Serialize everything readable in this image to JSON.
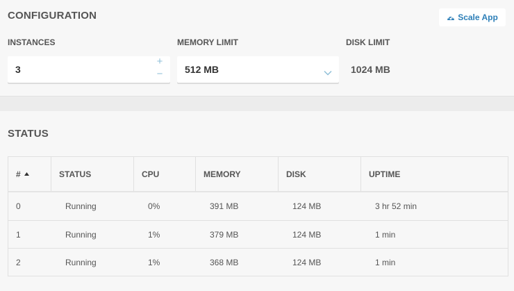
{
  "configuration": {
    "title": "CONFIGURATION",
    "scale_button": {
      "label": "Scale App",
      "icon": "dashboard-icon"
    },
    "instances": {
      "label": "INSTANCES",
      "value": "3",
      "plus": "+",
      "minus": "−"
    },
    "memory_limit": {
      "label": "MEMORY LIMIT",
      "value": "512 MB"
    },
    "disk_limit": {
      "label": "DISK LIMIT",
      "value": "1024 MB"
    }
  },
  "status": {
    "title": "STATUS",
    "columns": [
      "#",
      "STATUS",
      "CPU",
      "MEMORY",
      "DISK",
      "UPTIME"
    ],
    "sort_column": "#",
    "rows": [
      {
        "index": "0",
        "status": "Running",
        "cpu": "0%",
        "memory": "391 MB",
        "disk": "124 MB",
        "uptime": "3 hr 52 min"
      },
      {
        "index": "1",
        "status": "Running",
        "cpu": "1%",
        "memory": "379 MB",
        "disk": "124 MB",
        "uptime": "1 min"
      },
      {
        "index": "2",
        "status": "Running",
        "cpu": "1%",
        "memory": "368 MB",
        "disk": "124 MB",
        "uptime": "1 min"
      }
    ]
  },
  "colors": {
    "accent": "#2d7fb8",
    "stepper": "#8fbfd8",
    "background": "#f7f7f7"
  }
}
